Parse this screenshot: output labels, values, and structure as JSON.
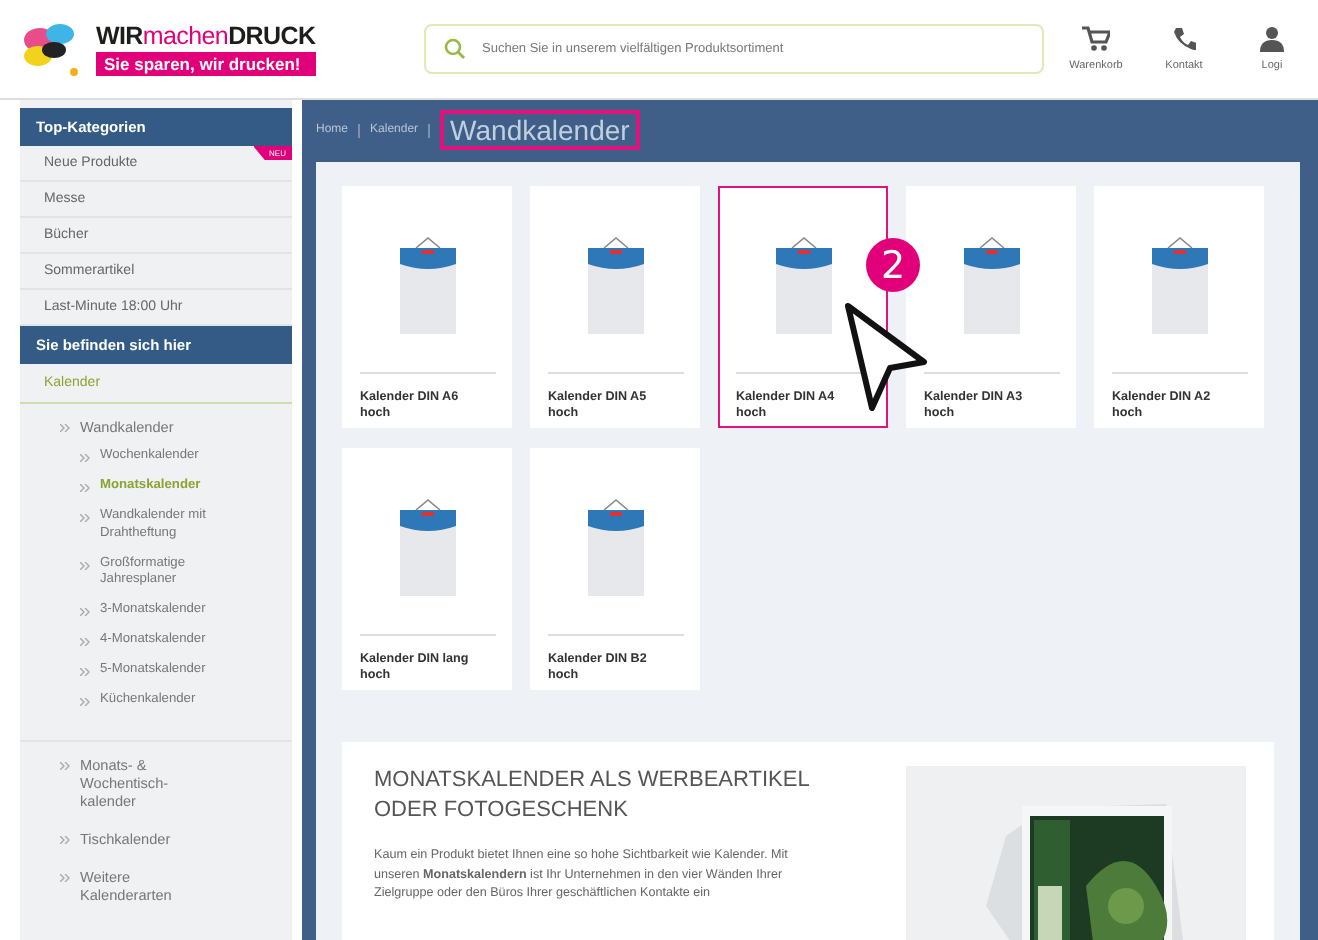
{
  "header": {
    "logo": {
      "words": [
        "WIR",
        "machen",
        "DRUCK"
      ],
      "tagline": "Sie sparen, wir drucken!"
    },
    "search": {
      "placeholder": "Suchen Sie in unserem vielfältigen Produktsortiment"
    },
    "actions": [
      {
        "kind": "cart",
        "label": "Warenkorb"
      },
      {
        "kind": "phone",
        "label": "Kontakt"
      },
      {
        "kind": "user",
        "label": "Logi"
      }
    ]
  },
  "sidebar": {
    "top_title": "Top-Kategorien",
    "top_items": [
      {
        "label": "Neue Produkte",
        "badge": "NEU"
      },
      {
        "label": "Messe"
      },
      {
        "label": "Bücher"
      },
      {
        "label": "Sommerartikel"
      },
      {
        "label": "Last-Minute 18:00 Uhr"
      }
    ],
    "here_title": "Sie befinden sich hier",
    "tree": [
      {
        "label": "Kalender",
        "selected": true,
        "children": [
          {
            "label": "Wandkalender",
            "selected": false,
            "children": [
              {
                "label": "Wochenkalender",
                "selected": false
              },
              {
                "label": "Monatskalender",
                "selected": true
              },
              {
                "label": "Wandkalender mit Drahtheftung",
                "selected": false
              },
              {
                "label": "Großformatige Jahresplaner",
                "selected": false
              },
              {
                "label": "3-Monatskalender",
                "selected": false
              },
              {
                "label": "4-Monatskalender",
                "selected": false
              },
              {
                "label": "5-Monatskalender",
                "selected": false
              },
              {
                "label": "Küchenkalender",
                "selected": false
              }
            ]
          },
          {
            "label": "Monats- & Wochentisch-kalender",
            "selected": false
          },
          {
            "label": "Tischkalender",
            "selected": false
          },
          {
            "label": "Weitere Kalenderarten",
            "selected": false
          }
        ]
      }
    ]
  },
  "breadcrumb": [
    {
      "label": "Home",
      "current": false
    },
    {
      "label": "Kalender",
      "current": false
    },
    {
      "label": "Wandkalender",
      "current": true
    }
  ],
  "products": [
    {
      "label": "Kalender DIN A6 hoch",
      "selected": false
    },
    {
      "label": "Kalender DIN A5 hoch",
      "selected": false
    },
    {
      "label": "Kalender DIN A4 hoch",
      "selected": true
    },
    {
      "label": "Kalender DIN A3 hoch",
      "selected": false
    },
    {
      "label": "Kalender DIN A2 hoch",
      "selected": false
    },
    {
      "label": "Kalender DIN lang hoch",
      "selected": false
    },
    {
      "label": "Kalender DIN B2 hoch",
      "selected": false
    }
  ],
  "annotation": {
    "badge": "2"
  },
  "article": {
    "title": "MONATSKALENDER ALS WERBEARTIKEL ODER FOTOGESCHENK",
    "body": "Kaum ein Produkt bietet Ihnen eine so hohe Sichtbarkeit wie Kalender. Mit unseren **Monatskalendern** ist Ihr Unternehmen in den vier Wänden Ihrer Zielgruppe oder den Büros Ihrer geschäftlichen Kontakte ein"
  }
}
